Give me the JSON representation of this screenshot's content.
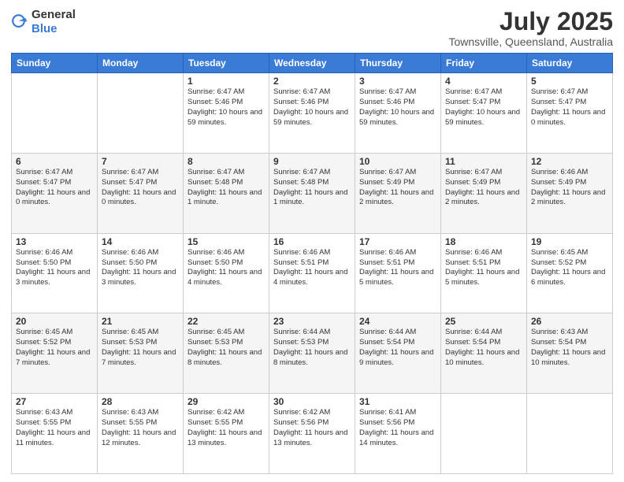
{
  "header": {
    "logo": {
      "text_general": "General",
      "text_blue": "Blue"
    },
    "title": "July 2025",
    "subtitle": "Townsville, Queensland, Australia"
  },
  "days_of_week": [
    "Sunday",
    "Monday",
    "Tuesday",
    "Wednesday",
    "Thursday",
    "Friday",
    "Saturday"
  ],
  "weeks": [
    [
      {
        "day": "",
        "sunrise": "",
        "sunset": "",
        "daylight": ""
      },
      {
        "day": "",
        "sunrise": "",
        "sunset": "",
        "daylight": ""
      },
      {
        "day": "1",
        "sunrise": "Sunrise: 6:47 AM",
        "sunset": "Sunset: 5:46 PM",
        "daylight": "Daylight: 10 hours and 59 minutes."
      },
      {
        "day": "2",
        "sunrise": "Sunrise: 6:47 AM",
        "sunset": "Sunset: 5:46 PM",
        "daylight": "Daylight: 10 hours and 59 minutes."
      },
      {
        "day": "3",
        "sunrise": "Sunrise: 6:47 AM",
        "sunset": "Sunset: 5:46 PM",
        "daylight": "Daylight: 10 hours and 59 minutes."
      },
      {
        "day": "4",
        "sunrise": "Sunrise: 6:47 AM",
        "sunset": "Sunset: 5:47 PM",
        "daylight": "Daylight: 10 hours and 59 minutes."
      },
      {
        "day": "5",
        "sunrise": "Sunrise: 6:47 AM",
        "sunset": "Sunset: 5:47 PM",
        "daylight": "Daylight: 11 hours and 0 minutes."
      }
    ],
    [
      {
        "day": "6",
        "sunrise": "Sunrise: 6:47 AM",
        "sunset": "Sunset: 5:47 PM",
        "daylight": "Daylight: 11 hours and 0 minutes."
      },
      {
        "day": "7",
        "sunrise": "Sunrise: 6:47 AM",
        "sunset": "Sunset: 5:47 PM",
        "daylight": "Daylight: 11 hours and 0 minutes."
      },
      {
        "day": "8",
        "sunrise": "Sunrise: 6:47 AM",
        "sunset": "Sunset: 5:48 PM",
        "daylight": "Daylight: 11 hours and 1 minute."
      },
      {
        "day": "9",
        "sunrise": "Sunrise: 6:47 AM",
        "sunset": "Sunset: 5:48 PM",
        "daylight": "Daylight: 11 hours and 1 minute."
      },
      {
        "day": "10",
        "sunrise": "Sunrise: 6:47 AM",
        "sunset": "Sunset: 5:49 PM",
        "daylight": "Daylight: 11 hours and 2 minutes."
      },
      {
        "day": "11",
        "sunrise": "Sunrise: 6:47 AM",
        "sunset": "Sunset: 5:49 PM",
        "daylight": "Daylight: 11 hours and 2 minutes."
      },
      {
        "day": "12",
        "sunrise": "Sunrise: 6:46 AM",
        "sunset": "Sunset: 5:49 PM",
        "daylight": "Daylight: 11 hours and 2 minutes."
      }
    ],
    [
      {
        "day": "13",
        "sunrise": "Sunrise: 6:46 AM",
        "sunset": "Sunset: 5:50 PM",
        "daylight": "Daylight: 11 hours and 3 minutes."
      },
      {
        "day": "14",
        "sunrise": "Sunrise: 6:46 AM",
        "sunset": "Sunset: 5:50 PM",
        "daylight": "Daylight: 11 hours and 3 minutes."
      },
      {
        "day": "15",
        "sunrise": "Sunrise: 6:46 AM",
        "sunset": "Sunset: 5:50 PM",
        "daylight": "Daylight: 11 hours and 4 minutes."
      },
      {
        "day": "16",
        "sunrise": "Sunrise: 6:46 AM",
        "sunset": "Sunset: 5:51 PM",
        "daylight": "Daylight: 11 hours and 4 minutes."
      },
      {
        "day": "17",
        "sunrise": "Sunrise: 6:46 AM",
        "sunset": "Sunset: 5:51 PM",
        "daylight": "Daylight: 11 hours and 5 minutes."
      },
      {
        "day": "18",
        "sunrise": "Sunrise: 6:46 AM",
        "sunset": "Sunset: 5:51 PM",
        "daylight": "Daylight: 11 hours and 5 minutes."
      },
      {
        "day": "19",
        "sunrise": "Sunrise: 6:45 AM",
        "sunset": "Sunset: 5:52 PM",
        "daylight": "Daylight: 11 hours and 6 minutes."
      }
    ],
    [
      {
        "day": "20",
        "sunrise": "Sunrise: 6:45 AM",
        "sunset": "Sunset: 5:52 PM",
        "daylight": "Daylight: 11 hours and 7 minutes."
      },
      {
        "day": "21",
        "sunrise": "Sunrise: 6:45 AM",
        "sunset": "Sunset: 5:53 PM",
        "daylight": "Daylight: 11 hours and 7 minutes."
      },
      {
        "day": "22",
        "sunrise": "Sunrise: 6:45 AM",
        "sunset": "Sunset: 5:53 PM",
        "daylight": "Daylight: 11 hours and 8 minutes."
      },
      {
        "day": "23",
        "sunrise": "Sunrise: 6:44 AM",
        "sunset": "Sunset: 5:53 PM",
        "daylight": "Daylight: 11 hours and 8 minutes."
      },
      {
        "day": "24",
        "sunrise": "Sunrise: 6:44 AM",
        "sunset": "Sunset: 5:54 PM",
        "daylight": "Daylight: 11 hours and 9 minutes."
      },
      {
        "day": "25",
        "sunrise": "Sunrise: 6:44 AM",
        "sunset": "Sunset: 5:54 PM",
        "daylight": "Daylight: 11 hours and 10 minutes."
      },
      {
        "day": "26",
        "sunrise": "Sunrise: 6:43 AM",
        "sunset": "Sunset: 5:54 PM",
        "daylight": "Daylight: 11 hours and 10 minutes."
      }
    ],
    [
      {
        "day": "27",
        "sunrise": "Sunrise: 6:43 AM",
        "sunset": "Sunset: 5:55 PM",
        "daylight": "Daylight: 11 hours and 11 minutes."
      },
      {
        "day": "28",
        "sunrise": "Sunrise: 6:43 AM",
        "sunset": "Sunset: 5:55 PM",
        "daylight": "Daylight: 11 hours and 12 minutes."
      },
      {
        "day": "29",
        "sunrise": "Sunrise: 6:42 AM",
        "sunset": "Sunset: 5:55 PM",
        "daylight": "Daylight: 11 hours and 13 minutes."
      },
      {
        "day": "30",
        "sunrise": "Sunrise: 6:42 AM",
        "sunset": "Sunset: 5:56 PM",
        "daylight": "Daylight: 11 hours and 13 minutes."
      },
      {
        "day": "31",
        "sunrise": "Sunrise: 6:41 AM",
        "sunset": "Sunset: 5:56 PM",
        "daylight": "Daylight: 11 hours and 14 minutes."
      },
      {
        "day": "",
        "sunrise": "",
        "sunset": "",
        "daylight": ""
      },
      {
        "day": "",
        "sunrise": "",
        "sunset": "",
        "daylight": ""
      }
    ]
  ]
}
